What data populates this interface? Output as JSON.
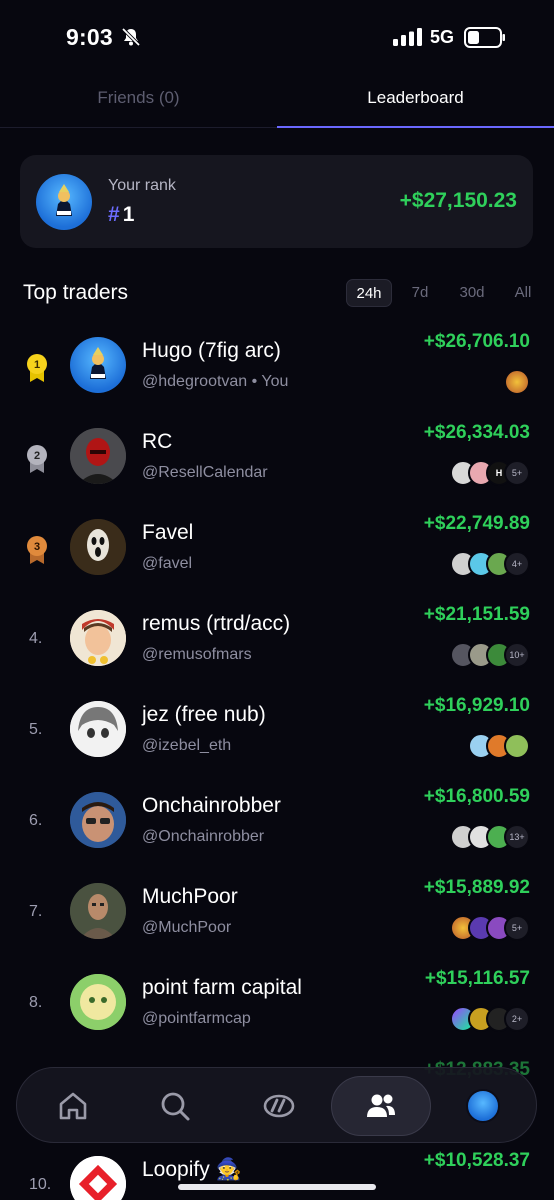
{
  "status_bar": {
    "time": "9:03",
    "network": "5G"
  },
  "tabs": [
    {
      "label": "Friends (0)",
      "active": false
    },
    {
      "label": "Leaderboard",
      "active": true
    }
  ],
  "your_rank": {
    "label": "Your rank",
    "hash": "#",
    "rank": "1",
    "pnl": "+$27,150.23"
  },
  "top_traders": {
    "title": "Top traders",
    "periods": [
      "24h",
      "7d",
      "30d",
      "All"
    ],
    "active_period": "24h"
  },
  "traders": [
    {
      "rank": "1",
      "name": "Hugo (7fig arc)",
      "handle": "@hdegrootvan • You",
      "pnl": "+$26,706.10",
      "more": ""
    },
    {
      "rank": "2",
      "name": "RC",
      "handle": "@ResellCalendar",
      "pnl": "+$26,334.03",
      "more": "5+"
    },
    {
      "rank": "3",
      "name": "Favel",
      "handle": "@favel",
      "pnl": "+$22,749.89",
      "more": "4+"
    },
    {
      "rank": "4.",
      "name": "remus (rtrd/acc)",
      "handle": "@remusofmars",
      "pnl": "+$21,151.59",
      "more": "10+"
    },
    {
      "rank": "5.",
      "name": "jez (free nub)",
      "handle": "@izebel_eth",
      "pnl": "+$16,929.10",
      "more": ""
    },
    {
      "rank": "6.",
      "name": "Onchainrobber",
      "handle": "@Onchainrobber",
      "pnl": "+$16,800.59",
      "more": "13+"
    },
    {
      "rank": "7.",
      "name": "MuchPoor",
      "handle": "@MuchPoor",
      "pnl": "+$15,889.92",
      "more": "5+"
    },
    {
      "rank": "8.",
      "name": "point farm capital",
      "handle": "@pointfarmcap",
      "pnl": "+$15,116.57",
      "more": "2+"
    },
    {
      "rank": "10.",
      "name": "Loopify 🧙",
      "handle": "",
      "pnl": "+$10,528.37",
      "more": ""
    }
  ],
  "hidden_row_pnl": "+$12,883.35",
  "nav": [
    "home-icon",
    "search-icon",
    "trending-icon",
    "friends-icon",
    "profile-avatar"
  ],
  "colors": {
    "accent": "#6a68ff",
    "positive": "#2fd05b",
    "background": "#07070f",
    "card": "#16161f"
  }
}
